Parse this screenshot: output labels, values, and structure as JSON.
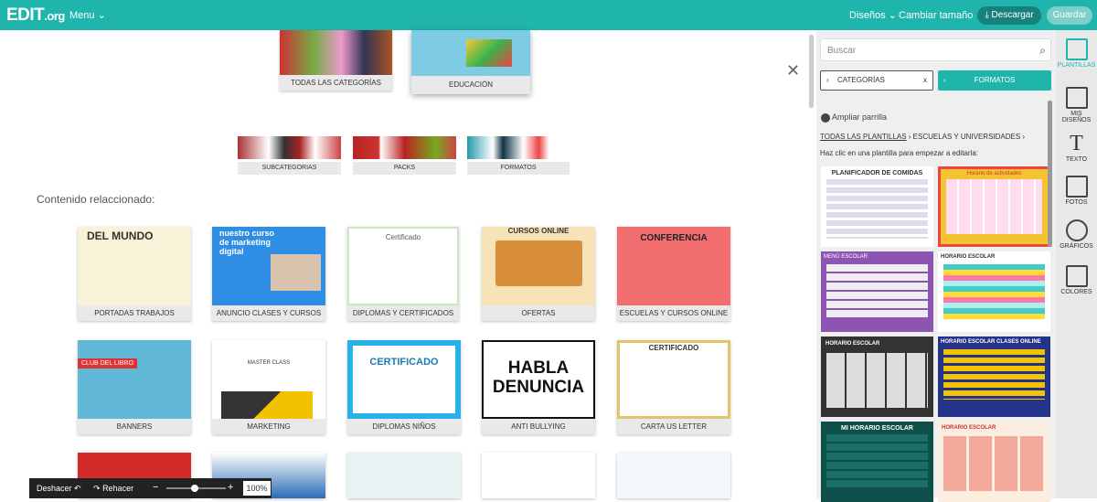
{
  "topbar": {
    "logo": "EDIT",
    "logo_suffix": ".org",
    "menu": "Menu",
    "disenos": "Diseños",
    "cambiar": "Cambiar tamaño",
    "descargar": "Descargar",
    "guardar": "Guardar",
    "color": "#1fb5ad"
  },
  "categories": {
    "todas": "TODAS LAS CATEGORÍAS",
    "educacion": "EDUCACIÓN",
    "sub": "SUBCATEGORIAS",
    "packs": "PACKS",
    "formatos": "FORMATOS"
  },
  "related_label": "Contenido relaccionado:",
  "related": [
    {
      "label": "PORTADAS TRABAJOS",
      "title": "DEL MUNDO"
    },
    {
      "label": "ANUNCIO CLASES Y CURSOS",
      "title": "nuestro curso de marketing digital"
    },
    {
      "label": "DIPLOMAS Y CERTIFICADOS",
      "title": "Certificado"
    },
    {
      "label": "OFERTAS",
      "title": "CURSOS ONLINE"
    },
    {
      "label": "ESCUELAS Y CURSOS ONLINE",
      "title": "CONFERENCIA"
    },
    {
      "label": "BANNERS",
      "title": "CLUB DEL LIBRO"
    },
    {
      "label": "MARKETING",
      "title": "MASTER CLASS"
    },
    {
      "label": "DIPLOMAS NIÑOS",
      "title": "CERTIFICADO"
    },
    {
      "label": "ANTI BULLYING",
      "title": "HABLA DENUNCIA"
    },
    {
      "label": "CARTA US LETTER",
      "title": "CERTIFICADO"
    }
  ],
  "bottom": {
    "undo": "Deshacer",
    "redo": "Rehacer",
    "zoom": "100%"
  },
  "panel": {
    "search_placeholder": "Buscar",
    "categorias": "CATEGORÍAS",
    "formatos": "FORMATOS",
    "ampliar": "Ampliar parrilla",
    "crumb1": "TODAS LAS PLANTILLAS",
    "crumb2": "ESCUELAS Y UNIVERSIDADES",
    "hint": "Haz clic en una plantilla para empezar a editarla:",
    "templates": [
      {
        "title": "PLANIFICADOR DE COMIDAS"
      },
      {
        "title": "Horario de actividades"
      },
      {
        "title": "MENÚ ESCOLAR"
      },
      {
        "title": "HORARIO ESCOLAR"
      },
      {
        "title": "HORARIO ESCOLAR"
      },
      {
        "title": "HORARIO ESCOLAR CLASES ONLINE"
      },
      {
        "title": "MI HORARIO ESCOLAR"
      },
      {
        "title": "HORARIO ESCOLAR"
      }
    ]
  },
  "sidebar": {
    "plantillas": "PLANTILLAS",
    "misdisenos": "MIS DISEÑOS",
    "texto": "TEXTO",
    "fotos": "FOTOS",
    "graficos": "GRÁFICOS",
    "colores": "COLORES"
  }
}
